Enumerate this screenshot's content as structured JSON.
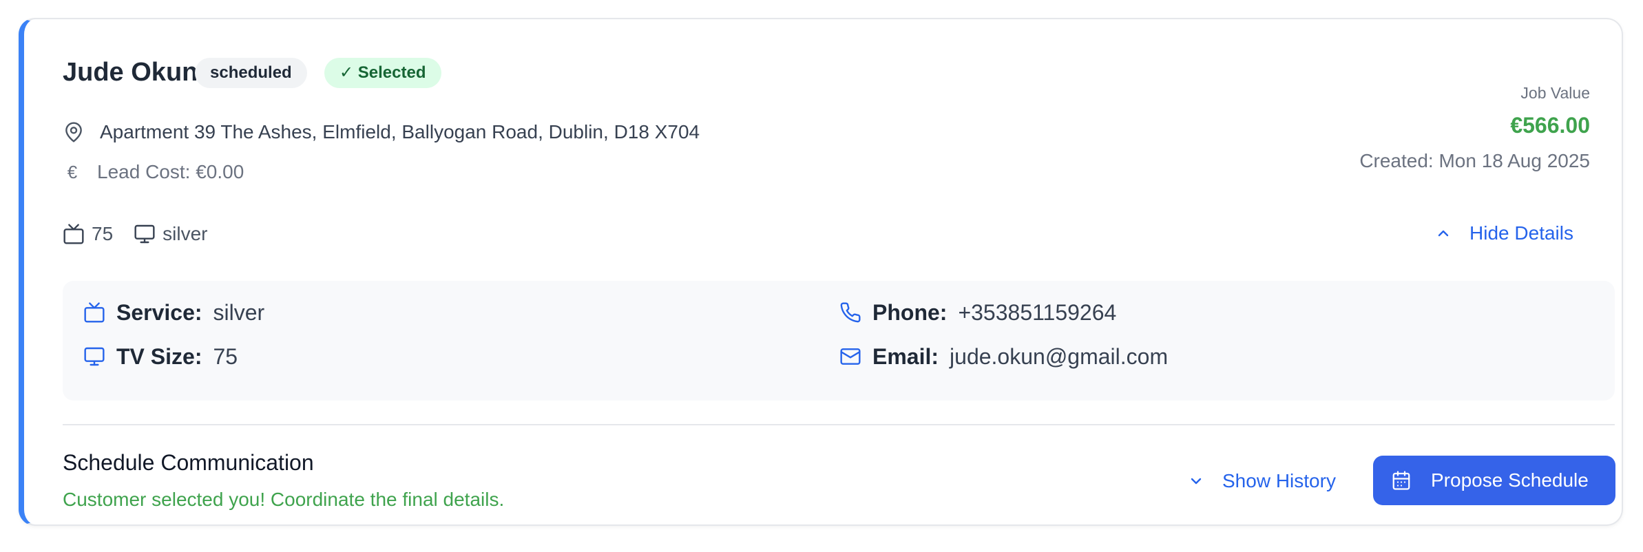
{
  "customer": {
    "name": "Jude Okun",
    "status_badge": "scheduled",
    "selected_badge": "✓ Selected",
    "address": "Apartment 39 The Ashes, Elmfield, Ballyogan Road, Dublin, D18 X704",
    "lead_cost": "Lead Cost: €0.00"
  },
  "job": {
    "value_label": "Job Value",
    "value": "€566.00",
    "created": "Created: Mon 18 Aug 2025"
  },
  "meta": {
    "tv_size": "75",
    "service": "silver"
  },
  "toggle_details_label": "Hide Details",
  "details": {
    "service_label": "Service:",
    "service_value": "silver",
    "tv_size_label": "TV Size:",
    "tv_size_value": "75",
    "phone_label": "Phone:",
    "phone_value": "+353851159264",
    "email_label": "Email:",
    "email_value": "jude.okun@gmail.com"
  },
  "schedule": {
    "title": "Schedule Communication",
    "subtitle": "Customer selected you! Coordinate the final details.",
    "history_label": "Show History",
    "propose_label": "Propose Schedule"
  },
  "colors": {
    "accent": "#3b82f6",
    "primary_button": "#3563e9",
    "success": "#3fa34d",
    "link": "#2563eb"
  },
  "icons": [
    "map-pin-icon",
    "euro-icon",
    "tv-icon",
    "monitor-icon",
    "chevron-up-icon",
    "phone-icon",
    "mail-icon",
    "chevron-down-icon",
    "calendar-icon"
  ]
}
